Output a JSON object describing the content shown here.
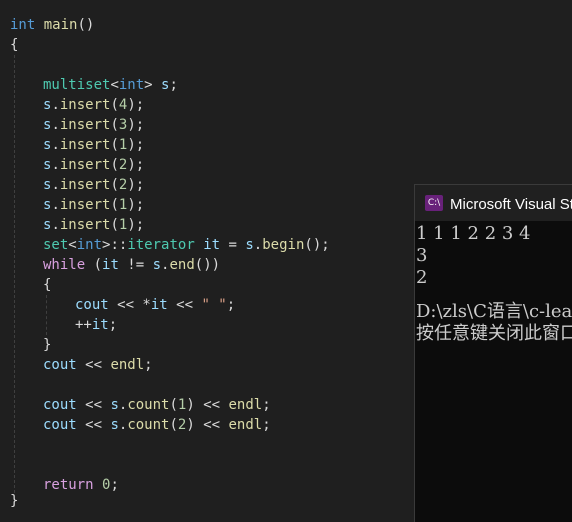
{
  "editor": {
    "lines": {
      "l1": [
        "int",
        " ",
        "main",
        "()"
      ],
      "l2": [
        "{"
      ],
      "l3": [
        "multiset",
        "<",
        "int",
        "> ",
        "s",
        ";"
      ],
      "l4": [
        "s",
        ".",
        "insert",
        "(",
        "4",
        ");"
      ],
      "l5": [
        "s",
        ".",
        "insert",
        "(",
        "3",
        ");"
      ],
      "l6": [
        "s",
        ".",
        "insert",
        "(",
        "1",
        ");"
      ],
      "l7": [
        "s",
        ".",
        "insert",
        "(",
        "2",
        ");"
      ],
      "l8": [
        "s",
        ".",
        "insert",
        "(",
        "2",
        ");"
      ],
      "l9": [
        "s",
        ".",
        "insert",
        "(",
        "1",
        ");"
      ],
      "l10": [
        "s",
        ".",
        "insert",
        "(",
        "1",
        ");"
      ],
      "l11": [
        "set",
        "<",
        "int",
        ">::",
        "iterator",
        " ",
        "it",
        " = ",
        "s",
        ".",
        "begin",
        "();"
      ],
      "l12": [
        "while",
        " (",
        "it",
        " != ",
        "s",
        ".",
        "end",
        "())"
      ],
      "l13": [
        "{"
      ],
      "l14": [
        "cout",
        " << *",
        "it",
        " << ",
        "\" \"",
        ";"
      ],
      "l15": [
        "++",
        "it",
        ";"
      ],
      "l16": [
        "}"
      ],
      "l17": [
        "cout",
        " << ",
        "endl",
        ";"
      ],
      "l18": [
        "cout",
        " << ",
        "s",
        ".",
        "count",
        "(",
        "1",
        ") << ",
        "endl",
        ";"
      ],
      "l19": [
        "cout",
        " << ",
        "s",
        ".",
        "count",
        "(",
        "2",
        ") << ",
        "endl",
        ";"
      ],
      "l20": [
        "return",
        " ",
        "0",
        ";"
      ],
      "l21": [
        "}"
      ]
    }
  },
  "console": {
    "title": "Microsoft Visual Studio 调试控制台",
    "icon_text": "C:\\",
    "output": [
      "1 1 1 2 2 3 4",
      "3",
      "2",
      "",
      "D:\\zls\\C语言\\c-learning",
      "按任意键关闭此窗口. . ."
    ]
  }
}
